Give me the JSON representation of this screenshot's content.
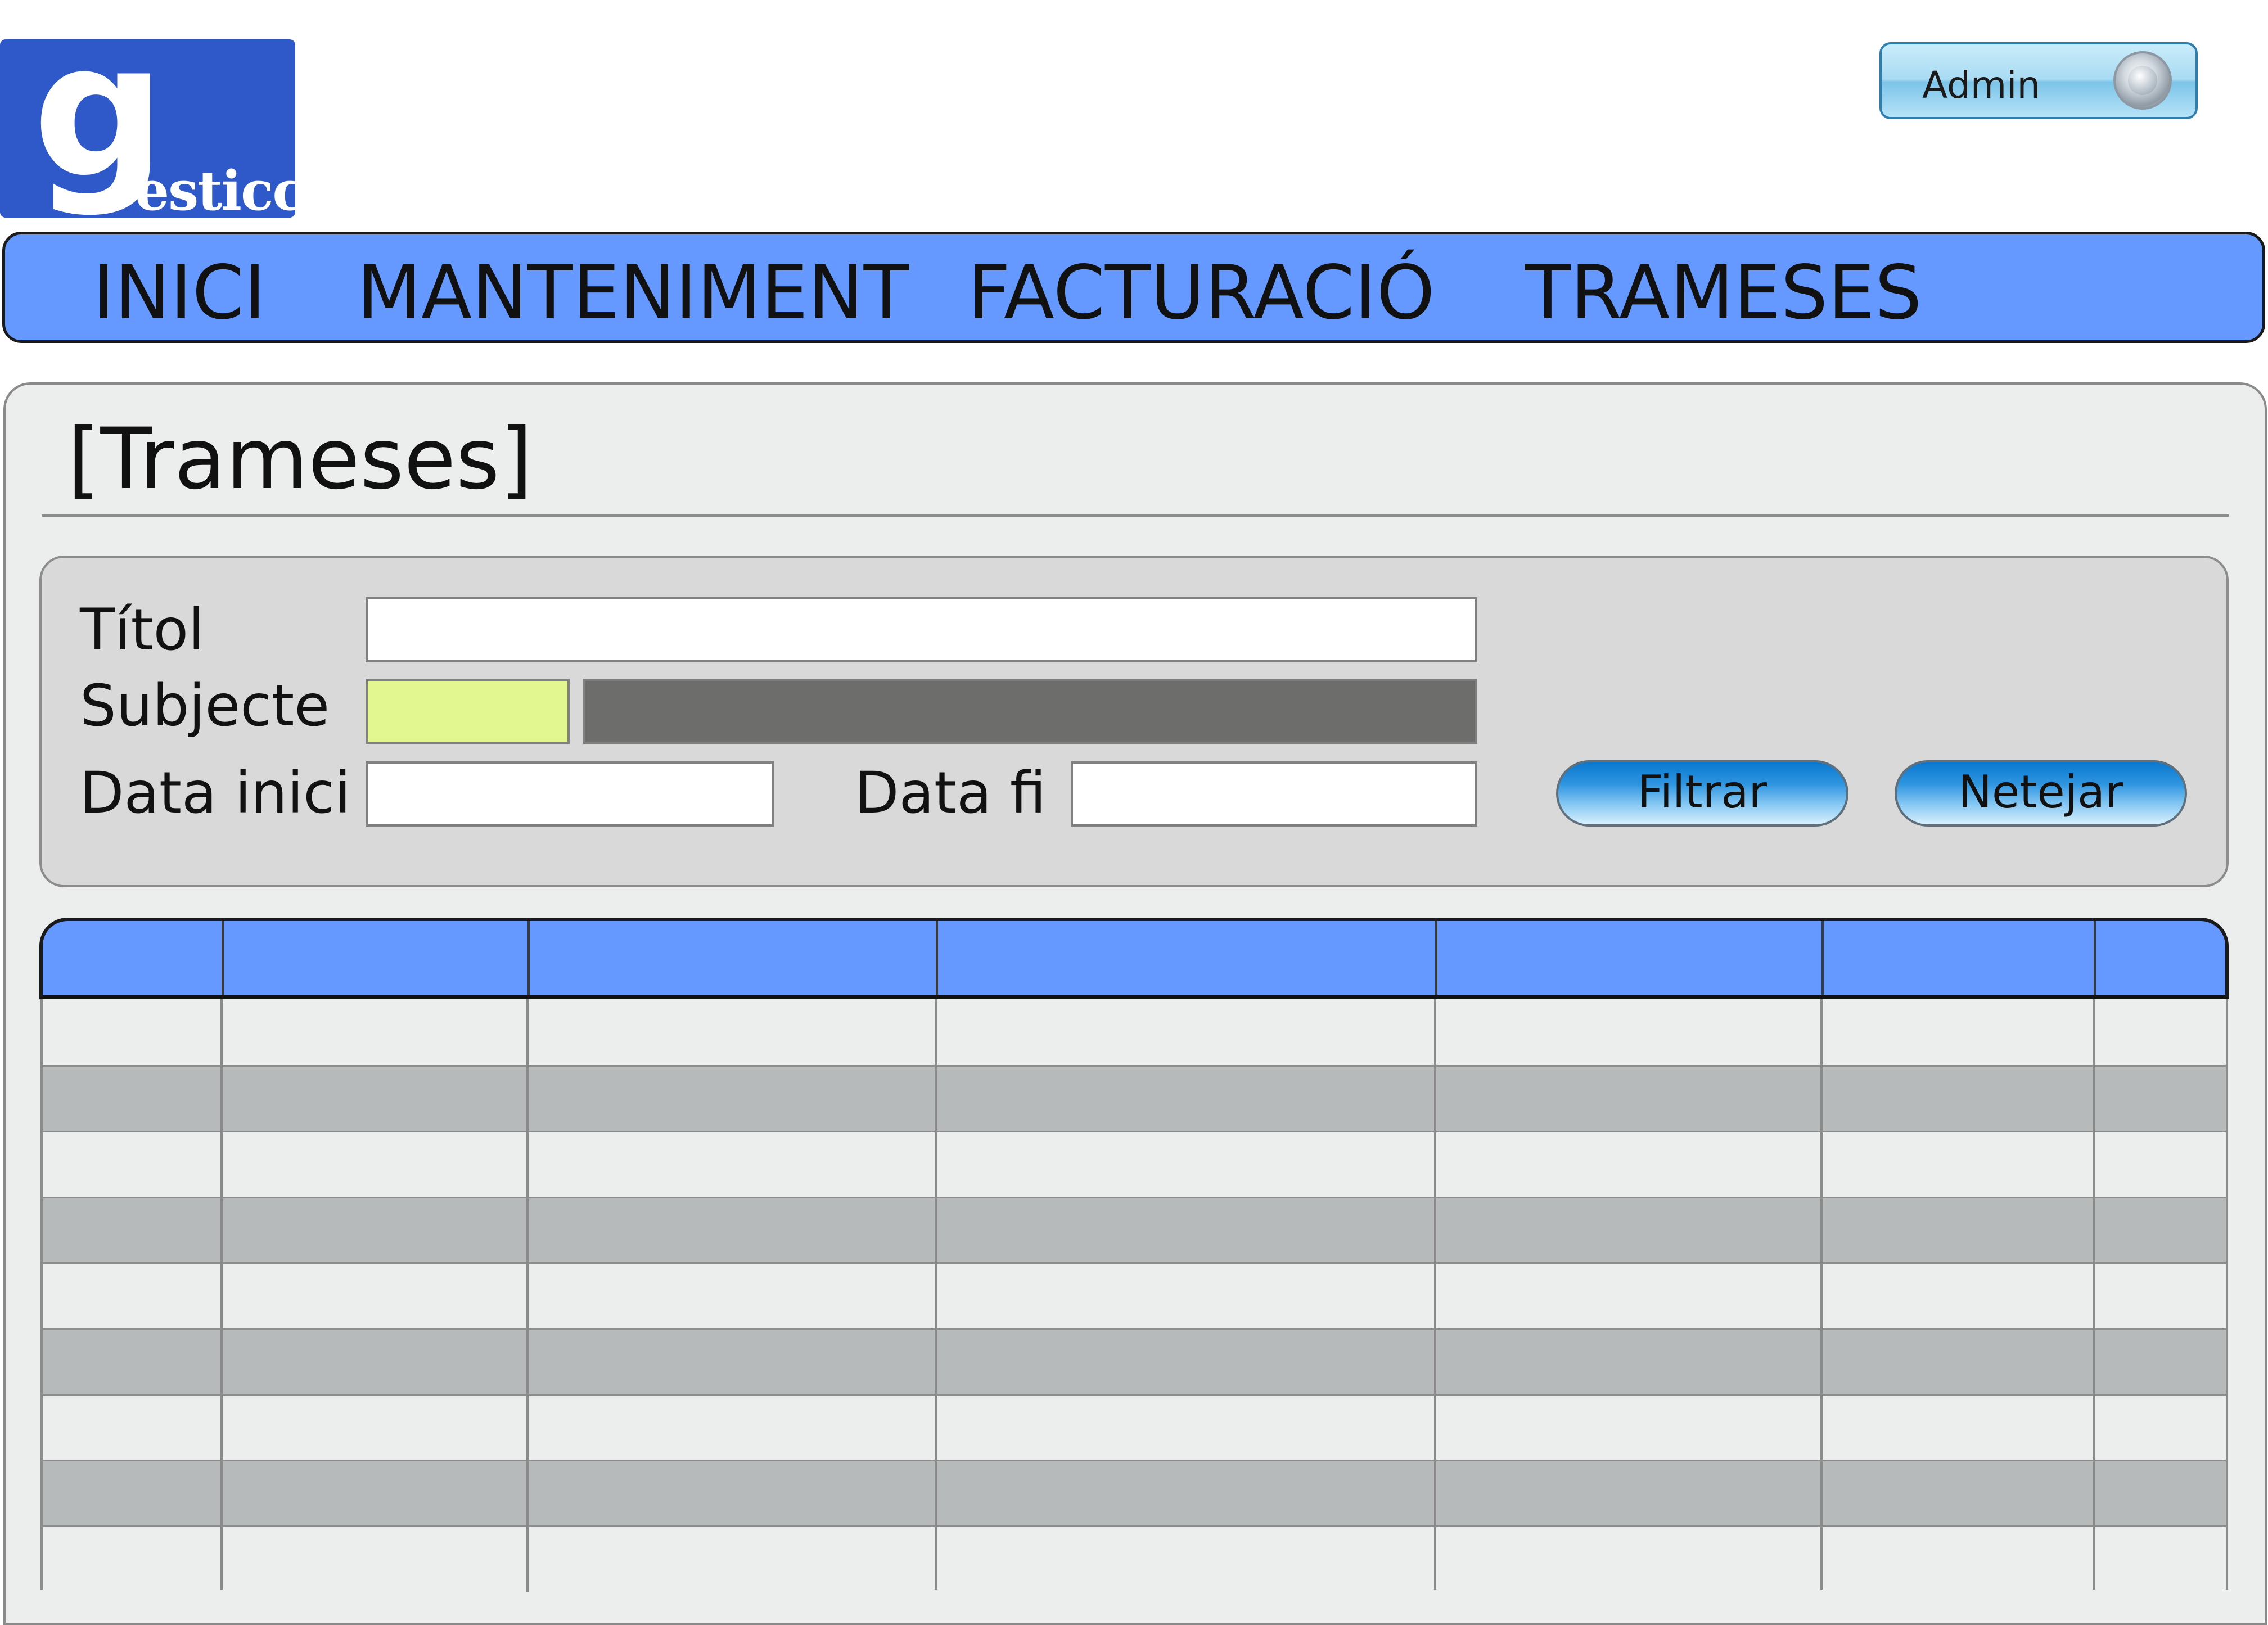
{
  "logo": {
    "initial": "g",
    "rest": "esticc",
    "brand_color": "#2f58c8"
  },
  "user_button": {
    "label": "Admin"
  },
  "nav": {
    "items": [
      {
        "label": "INICI"
      },
      {
        "label": "MANTENIMENT"
      },
      {
        "label": "FACTURACIÓ"
      },
      {
        "label": "TRAMESES"
      }
    ],
    "bar_color": "#6699ff"
  },
  "page": {
    "title": "[Trameses]"
  },
  "filters": {
    "titol_label": "Títol",
    "titol_value": "",
    "subjecte_label": "Subjecte",
    "subjecte_code_value": "",
    "subjecte_name_value": "",
    "data_inici_label": "Data inici",
    "data_inici_value": "",
    "data_fi_label": "Data fi",
    "data_fi_value": "",
    "filter_button": "Filtrar",
    "clear_button": "Netejar"
  },
  "table": {
    "headers": [
      "",
      "",
      "",
      "",
      "",
      "",
      ""
    ],
    "rows": [
      [
        "",
        "",
        "",
        "",
        "",
        "",
        ""
      ],
      [
        "",
        "",
        "",
        "",
        "",
        "",
        ""
      ],
      [
        "",
        "",
        "",
        "",
        "",
        "",
        ""
      ],
      [
        "",
        "",
        "",
        "",
        "",
        "",
        ""
      ],
      [
        "",
        "",
        "",
        "",
        "",
        "",
        ""
      ],
      [
        "",
        "",
        "",
        "",
        "",
        "",
        ""
      ],
      [
        "",
        "",
        "",
        "",
        "",
        "",
        ""
      ],
      [
        "",
        "",
        "",
        "",
        "",
        "",
        ""
      ],
      [
        "",
        "",
        "",
        "",
        "",
        "",
        ""
      ]
    ],
    "header_color": "#6699ff",
    "alt_row_color": "#b7babb"
  }
}
